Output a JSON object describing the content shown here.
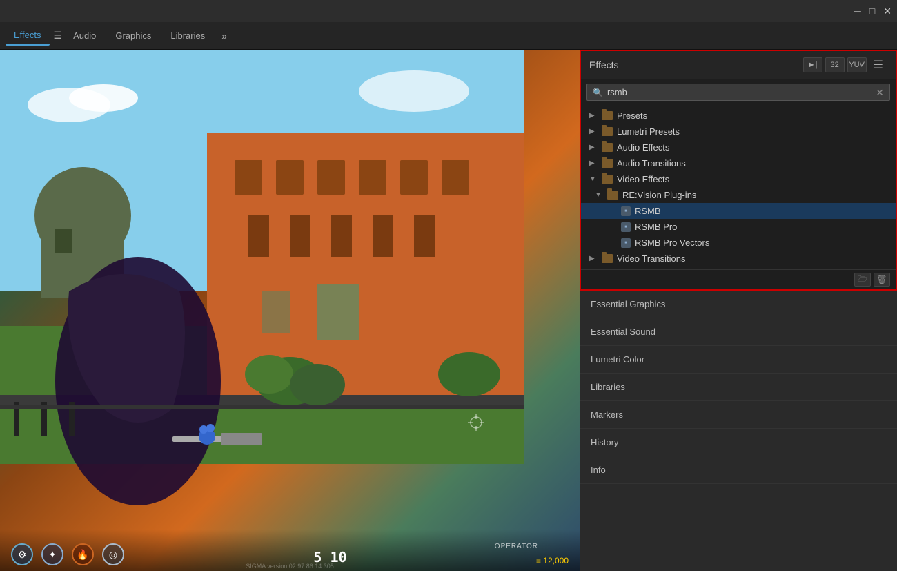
{
  "titlebar": {
    "minimize": "─",
    "maximize": "□",
    "close": "✕"
  },
  "tabs": [
    {
      "id": "effects",
      "label": "Effects",
      "active": true
    },
    {
      "id": "audio",
      "label": "Audio"
    },
    {
      "id": "graphics",
      "label": "Graphics"
    },
    {
      "id": "libraries",
      "label": "Libraries"
    }
  ],
  "effects_panel": {
    "title": "Effects",
    "menu_icon": "☰",
    "search_value": "rsmb",
    "search_placeholder": "Search",
    "icon_accelerate": "►",
    "icon_32": "32",
    "icon_yuv": "YUV",
    "tree": [
      {
        "id": "presets",
        "label": "Presets",
        "level": 0,
        "expanded": false,
        "type": "folder"
      },
      {
        "id": "lumetri",
        "label": "Lumetri Presets",
        "level": 0,
        "expanded": false,
        "type": "folder"
      },
      {
        "id": "audio-effects",
        "label": "Audio Effects",
        "level": 0,
        "expanded": false,
        "type": "folder"
      },
      {
        "id": "audio-transitions",
        "label": "Audio Transitions",
        "level": 0,
        "expanded": false,
        "type": "folder"
      },
      {
        "id": "video-effects",
        "label": "Video Effects",
        "level": 0,
        "expanded": true,
        "type": "folder"
      },
      {
        "id": "revision-plugins",
        "label": "RE:Vision Plug-ins",
        "level": 1,
        "expanded": true,
        "type": "folder"
      },
      {
        "id": "rsmb",
        "label": "RSMB",
        "level": 2,
        "type": "effect"
      },
      {
        "id": "rsmb-pro",
        "label": "RSMB Pro",
        "level": 2,
        "type": "effect"
      },
      {
        "id": "rsmb-pro-vectors",
        "label": "RSMB Pro Vectors",
        "level": 2,
        "type": "effect"
      },
      {
        "id": "video-transitions",
        "label": "Video Transitions",
        "level": 0,
        "expanded": false,
        "type": "folder"
      }
    ],
    "footer": {
      "folder_icon": "🗁",
      "delete_icon": "🗑"
    }
  },
  "side_panels": [
    "Essential Graphics",
    "Essential Sound",
    "Lumetri Color",
    "Libraries",
    "Markers",
    "History",
    "Info"
  ],
  "hud": {
    "ability1": "⚙",
    "ability2": "✦",
    "ability3": "🔥",
    "ability4": "◎",
    "ammo": "5  10",
    "kills": "≡ 12,000",
    "tag": "OPERATOR",
    "version": "SIGMA version 02.97.86.14.305"
  }
}
